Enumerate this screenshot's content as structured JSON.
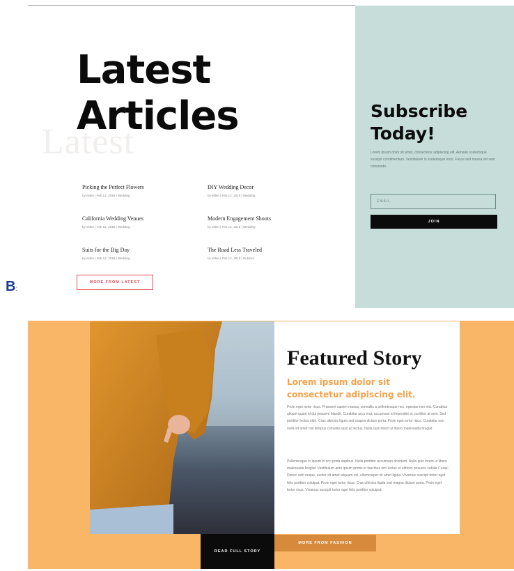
{
  "latest": {
    "ghost_word": "Latest",
    "title_line1": "Latest",
    "title_line2": "Articles",
    "articles": [
      {
        "title": "Picking the Perfect Flowers",
        "meta": "by elden | Feb 12, 2018 | Wedding"
      },
      {
        "title": "DIY Wedding Decor",
        "meta": "by elden | Feb 12, 2018 | Wedding"
      },
      {
        "title": "California Wedding Venues",
        "meta": "by elden | Feb 12, 2018 | Wedding"
      },
      {
        "title": "Modern Engagement Shoots",
        "meta": "by elden | Feb 12, 2018 | Wedding"
      },
      {
        "title": "Suits for the Big Day",
        "meta": "by elden | Feb 12, 2018 | Wedding"
      },
      {
        "title": "The Road Less Traveled",
        "meta": "by elden | Feb 12, 2018 | Outdoor"
      }
    ],
    "more_button": "MORE FROM LATEST"
  },
  "section_letter": "B",
  "section_letter_suffix": ":",
  "subscribe": {
    "title_line1": "Subscribe",
    "title_line2": "Today!",
    "text": "Lorem ipsum dolor sit amet, consectetur adipiscing elit. Aenean scelerisque suscipit condimentum. Vestibulum in scelerisque eros. Fusce sed massa vel sem commodo.",
    "email_placeholder": "EMAIL",
    "join_button": "JOIN"
  },
  "featured": {
    "title": "Featured Story",
    "subtitle_line1": "Lorem ipsum dolor sit",
    "subtitle_line2": "consectetur adipiscing elit.",
    "paragraph1": "Proin eget tortor risus. Praesent sapien massa, convallis a pellentesque nec, egestas non nisi. Curabitur aliquet quam id dui posuere blandit. Curabitur arcu erat, accumsan id imperdiet et, porttitor at sem. Sed porttitor lectus nibh. Cras ultricies ligula sed magna dictum porta. Proin eget tortor risus. Curabitur non nulla sit amet nisl tempus convallis quis ac lectus. Nulla quis lorem ut libero malesuada feugiat.",
    "paragraph2": "Pellentesque in ipsum id orci porta dapibus. Nulla porttitor accumsan tincidunt. Nulla quis lorem ut libero malesuada feugiat. Vestibulum ante ipsum primis in faucibus orci luctus et ultrices posuere cubilia Curae; Donec velit neque, auctor sit amet aliquam vel, ullamcorper sit amet ligula. Vivamus suscipit tortor eget felis porttitor volutpat. Proin eget tortor risus. Cras ultricies ligula sed magna dictum porta. Proin eget tortor risus. Vivamus suscipit tortor eget felis porttitor volutpat.",
    "read_button": "READ FULL STORY",
    "more_button": "MORE FROM FASHION"
  },
  "colors": {
    "accent_red": "#e34a52",
    "subscribe_bg": "#c6ddd9",
    "featured_bg": "#f8b666",
    "featured_subtitle": "#f5a24b",
    "more_fashion_bg": "#d78a3c"
  }
}
